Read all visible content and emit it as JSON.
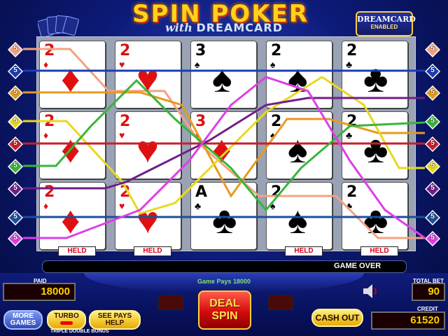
{
  "title": {
    "main": "SPIN POKER",
    "with": "with",
    "brand": "DREAMCARD"
  },
  "badge": {
    "line1": "DREAMCARD",
    "line2": "ENABLED"
  },
  "line_markers_left": [
    {
      "num": "5",
      "color": "#f2a37f"
    },
    {
      "num": "5",
      "color": "#1a3db8"
    },
    {
      "num": "5",
      "color": "#e79a1e"
    },
    {
      "num": "5",
      "color": "#e8d821"
    },
    {
      "num": "5",
      "color": "#c61f2b"
    },
    {
      "num": "5",
      "color": "#36b63a"
    },
    {
      "num": "5",
      "color": "#6f1e87"
    },
    {
      "num": "5",
      "color": "#1c4f9c"
    },
    {
      "num": "5",
      "color": "#dc3fe8"
    }
  ],
  "line_markers_right": [
    {
      "num": "5",
      "color": "#f2a37f"
    },
    {
      "num": "5",
      "color": "#1a3db8"
    },
    {
      "num": "5",
      "color": "#e79a1e"
    },
    {
      "num": "5",
      "color": "#36b63a"
    },
    {
      "num": "5",
      "color": "#c61f2b"
    },
    {
      "num": "5",
      "color": "#e8d821"
    },
    {
      "num": "5",
      "color": "#6f1e87"
    },
    {
      "num": "5",
      "color": "#1c4f9c"
    },
    {
      "num": "5",
      "color": "#dc3fe8"
    }
  ],
  "cards": [
    [
      {
        "rank": "2",
        "suit": "♦",
        "color": "red"
      },
      {
        "rank": "2",
        "suit": "♥",
        "color": "red"
      },
      {
        "rank": "3",
        "suit": "♠",
        "color": "blk"
      },
      {
        "rank": "2",
        "suit": "♠",
        "color": "blk"
      },
      {
        "rank": "2",
        "suit": "♣",
        "color": "blk"
      }
    ],
    [
      {
        "rank": "2",
        "suit": "♦",
        "color": "red"
      },
      {
        "rank": "2",
        "suit": "♥",
        "color": "red"
      },
      {
        "rank": "3",
        "suit": "♦",
        "color": "red"
      },
      {
        "rank": "2",
        "suit": "♠",
        "color": "blk"
      },
      {
        "rank": "2",
        "suit": "♣",
        "color": "blk"
      }
    ],
    [
      {
        "rank": "2",
        "suit": "♦",
        "color": "red"
      },
      {
        "rank": "2",
        "suit": "♥",
        "color": "red"
      },
      {
        "rank": "A",
        "suit": "♣",
        "color": "blk"
      },
      {
        "rank": "2",
        "suit": "♠",
        "color": "blk"
      },
      {
        "rank": "2",
        "suit": "♣",
        "color": "blk"
      }
    ]
  ],
  "held": [
    "HELD",
    "HELD",
    "",
    "HELD",
    "HELD"
  ],
  "status": "GAME OVER",
  "game_pays": "Game Pays 18000",
  "paid": {
    "label": "PAID",
    "value": "18000"
  },
  "total_bet": {
    "label": "TOTAL BET",
    "value": "90"
  },
  "credit": {
    "label": "CREDIT",
    "value": "61520"
  },
  "buttons": {
    "more_games_1": "MORE",
    "more_games_2": "GAMES",
    "turbo": "TURBO",
    "see_pays_1": "SEE PAYS",
    "see_pays_2": "HELP",
    "deal_1": "DEAL",
    "deal_2": "SPIN",
    "cash_out": "CASH OUT"
  },
  "game_name": "TRIPLE DOUBLE BONUS"
}
